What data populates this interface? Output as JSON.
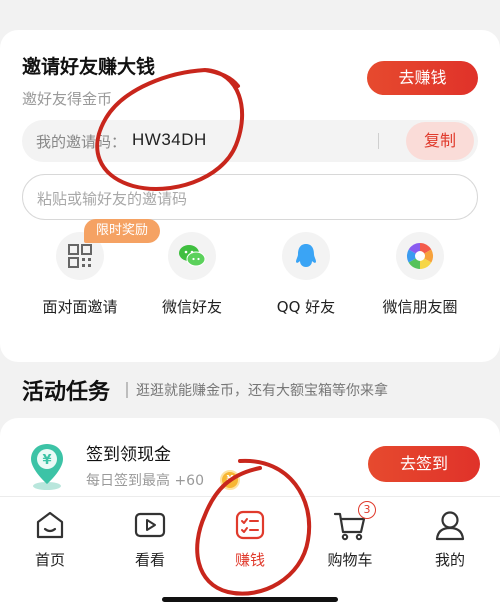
{
  "invite": {
    "title": "邀请好友赚大钱",
    "subtitle": "邀好友得金币",
    "earn_button": "去赚钱",
    "code_label": "我的邀请码：",
    "code_value": "HW34DH",
    "copy_button": "复制",
    "paste_placeholder": "粘贴或输好友的邀请码",
    "promo_badge": "限时奖励",
    "share_options": [
      {
        "label": "面对面邀请",
        "icon": "qr-code-icon"
      },
      {
        "label": "微信好友",
        "icon": "wechat-icon"
      },
      {
        "label": "QQ 好友",
        "icon": "qq-icon"
      },
      {
        "label": "微信朋友圈",
        "icon": "moments-icon"
      }
    ]
  },
  "tasks": {
    "title": "活动任务",
    "description": "逛逛就能赚金币，还有大额宝箱等你来拿",
    "items": [
      {
        "title": "签到领现金",
        "subtitle": "每日签到最高 +60",
        "button": "去签到",
        "icon": "cash-pin-icon"
      }
    ]
  },
  "bottom_nav": {
    "items": [
      {
        "label": "首页",
        "icon": "home-icon"
      },
      {
        "label": "看看",
        "icon": "video-icon"
      },
      {
        "label": "赚钱",
        "icon": "earn-icon",
        "active": true
      },
      {
        "label": "购物车",
        "icon": "cart-icon",
        "badge": "3"
      },
      {
        "label": "我的",
        "icon": "profile-icon"
      }
    ]
  },
  "colors": {
    "accent": "#e03a2c",
    "promo": "#f5a263",
    "annotation": "#c8261c",
    "background": "#f2f2f2"
  }
}
